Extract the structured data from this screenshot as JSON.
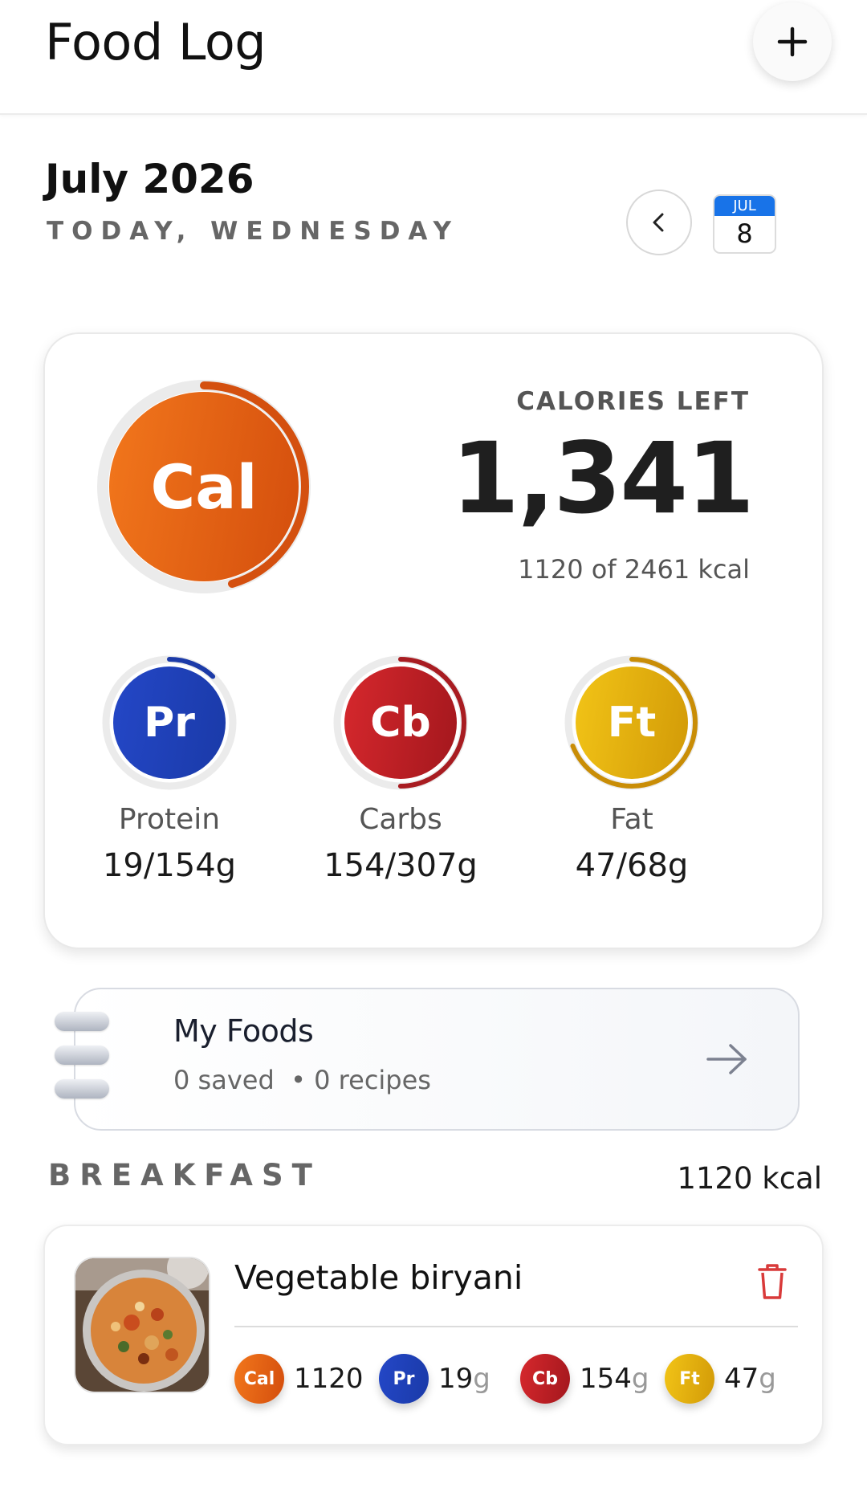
{
  "header": {
    "title": "Food Log",
    "add_icon": "plus-icon"
  },
  "date": {
    "month_year": "July 2026",
    "day_label": "TODAY, WEDNESDAY",
    "prev_icon": "chevron-left-icon",
    "calendar": {
      "month": "JUL",
      "day": "8",
      "icon": "calendar-icon"
    }
  },
  "summary": {
    "ring_label": "Cal",
    "calories_left_label": "CALORIES LEFT",
    "calories_left_value": "1,341",
    "calories_sub": "1120 of 2461 kcal",
    "calories_progress": 0.455,
    "macros": [
      {
        "abbr": "Pr",
        "name": "Protein",
        "value": "19/154g",
        "progress": 0.12,
        "color_start": "#2447c7",
        "color_end": "#1a3aa8",
        "ring": "#1c3ba8"
      },
      {
        "abbr": "Cb",
        "name": "Carbs",
        "value": "154/307g",
        "progress": 0.5,
        "color_start": "#d6282d",
        "color_end": "#a3171d",
        "ring": "#a81c21"
      },
      {
        "abbr": "Ft",
        "name": "Fat",
        "value": "47/68g",
        "progress": 0.69,
        "color_start": "#f2c417",
        "color_end": "#d29a07",
        "ring": "#c98d06"
      }
    ]
  },
  "my_foods": {
    "title": "My Foods",
    "saved": "0 saved",
    "recipes": "0 recipes",
    "arrow_icon": "arrow-right-icon"
  },
  "sections": [
    {
      "title": "BREAKFAST",
      "kcal": "1120 kcal",
      "entries": [
        {
          "name": "Vegetable biryani",
          "delete_icon": "trash-icon",
          "cal": "1120",
          "protein": "19",
          "carbs": "154",
          "fat": "47",
          "unit": "g",
          "chip_labels": {
            "cal": "Cal",
            "protein": "Pr",
            "carbs": "Cb",
            "fat": "Ft"
          }
        }
      ]
    }
  ],
  "colors": {
    "calorie_start": "#f2771c",
    "calorie_end": "#d44e0d",
    "calendar_blue": "#1873e8",
    "trash_red": "#d93a3a"
  }
}
